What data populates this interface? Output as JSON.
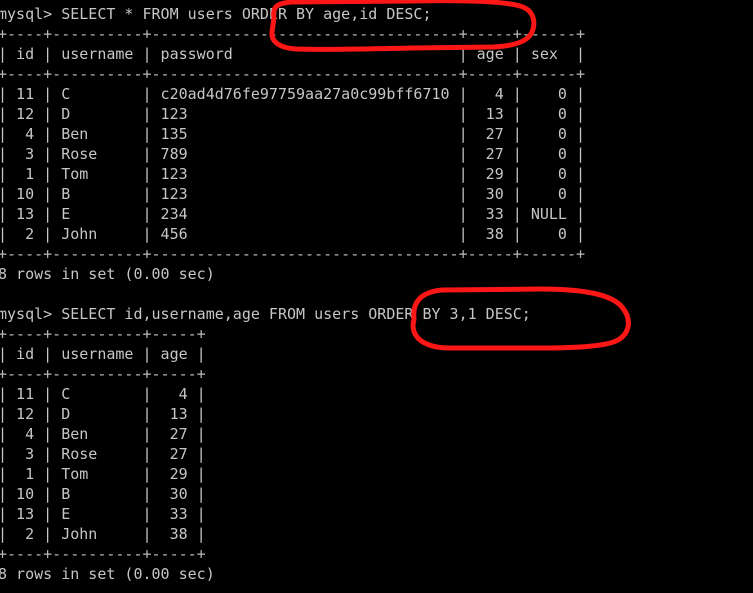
{
  "terminal": {
    "prompt": "mysql> ",
    "lines": [
      {
        "type": "prompt",
        "text": "mysql> SELECT * FROM users ORDER BY age,id DESC;"
      },
      {
        "type": "rule",
        "text": "+----+----------+----------------------------------+-----+------+"
      },
      {
        "type": "header",
        "text": "| id | username | password                         | age | sex  |"
      },
      {
        "type": "rule",
        "text": "+----+----------+----------------------------------+-----+------+"
      },
      {
        "type": "row",
        "text": "| 11 | C        | c20ad4d76fe97759aa27a0c99bff6710 |   4 |    0 |"
      },
      {
        "type": "row",
        "text": "| 12 | D        | 123                              |  13 |    0 |"
      },
      {
        "type": "row",
        "text": "|  4 | Ben      | 135                              |  27 |    0 |"
      },
      {
        "type": "row",
        "text": "|  3 | Rose     | 789                              |  27 |    0 |"
      },
      {
        "type": "row",
        "text": "|  1 | Tom      | 123                              |  29 |    0 |"
      },
      {
        "type": "row",
        "text": "| 10 | B        | 123                              |  30 |    0 |"
      },
      {
        "type": "row",
        "text": "| 13 | E        | 234                              |  33 | NULL |"
      },
      {
        "type": "row",
        "text": "|  2 | John     | 456                              |  38 |    0 |"
      },
      {
        "type": "rule",
        "text": "+----+----------+----------------------------------+-----+------+"
      },
      {
        "type": "status",
        "text": "8 rows in set (0.00 sec)"
      },
      {
        "type": "blank",
        "text": " "
      },
      {
        "type": "prompt",
        "text": "mysql> SELECT id,username,age FROM users ORDER BY 3,1 DESC;"
      },
      {
        "type": "rule",
        "text": "+----+----------+-----+"
      },
      {
        "type": "header",
        "text": "| id | username | age |"
      },
      {
        "type": "rule",
        "text": "+----+----------+-----+"
      },
      {
        "type": "row",
        "text": "| 11 | C        |   4 |"
      },
      {
        "type": "row",
        "text": "| 12 | D        |  13 |"
      },
      {
        "type": "row",
        "text": "|  4 | Ben      |  27 |"
      },
      {
        "type": "row",
        "text": "|  3 | Rose     |  27 |"
      },
      {
        "type": "row",
        "text": "|  1 | Tom      |  29 |"
      },
      {
        "type": "row",
        "text": "| 10 | B        |  30 |"
      },
      {
        "type": "row",
        "text": "| 13 | E        |  33 |"
      },
      {
        "type": "row",
        "text": "|  2 | John     |  38 |"
      },
      {
        "type": "rule",
        "text": "+----+----------+-----+"
      },
      {
        "type": "status",
        "text": "8 rows in set (0.00 sec)"
      }
    ]
  },
  "queries": [
    {
      "id": "query-1",
      "sql": "SELECT * FROM users ORDER BY age,id DESC;",
      "highlighted_clause": "ORDER BY age,id DESC;",
      "result": {
        "columns": [
          "id",
          "username",
          "password",
          "age",
          "sex"
        ],
        "rows": [
          [
            "11",
            "C",
            "c20ad4d76fe97759aa27a0c99bff6710",
            "4",
            "0"
          ],
          [
            "12",
            "D",
            "123",
            "13",
            "0"
          ],
          [
            "4",
            "Ben",
            "135",
            "27",
            "0"
          ],
          [
            "3",
            "Rose",
            "789",
            "27",
            "0"
          ],
          [
            "1",
            "Tom",
            "123",
            "29",
            "0"
          ],
          [
            "10",
            "B",
            "123",
            "30",
            "0"
          ],
          [
            "13",
            "E",
            "234",
            "33",
            "NULL"
          ],
          [
            "2",
            "John",
            "456",
            "38",
            "0"
          ]
        ],
        "status": "8 rows in set (0.00 sec)"
      }
    },
    {
      "id": "query-2",
      "sql": "SELECT id,username,age FROM users ORDER BY 3,1 DESC;",
      "highlighted_clause": "ORDER BY 3,1 DESC;",
      "result": {
        "columns": [
          "id",
          "username",
          "age"
        ],
        "rows": [
          [
            "11",
            "C",
            "4"
          ],
          [
            "12",
            "D",
            "13"
          ],
          [
            "4",
            "Ben",
            "27"
          ],
          [
            "3",
            "Rose",
            "27"
          ],
          [
            "1",
            "Tom",
            "29"
          ],
          [
            "10",
            "B",
            "30"
          ],
          [
            "13",
            "E",
            "33"
          ],
          [
            "2",
            "John",
            "38"
          ]
        ],
        "status": "8 rows in set (0.00 sec)"
      }
    }
  ],
  "annotations": [
    {
      "id": "annotation-query1",
      "shape": "hand-drawn-oval",
      "color": "#fc1616",
      "target": "ORDER BY age,id DESC;"
    },
    {
      "id": "annotation-query2",
      "shape": "hand-drawn-oval",
      "color": "#fc1616",
      "target": "ORDER BY 3,1 DESC;"
    }
  ],
  "colors": {
    "background": "#000000",
    "text": "#c6c6c6",
    "annotation": "#fc1616"
  }
}
